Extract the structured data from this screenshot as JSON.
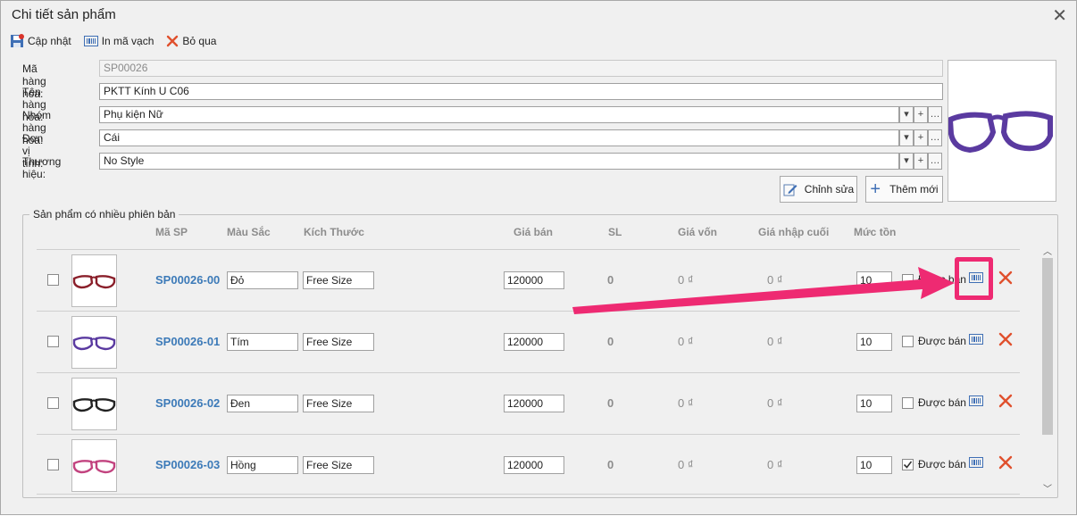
{
  "window": {
    "title": "Chi tiết sản phẩm"
  },
  "toolbar": {
    "update_label": "Cập nhật",
    "barcode_label": "In mã vạch",
    "skip_label": "Bỏ qua"
  },
  "form": {
    "code_label": "Mã hàng hóa:",
    "code_value": "SP00026",
    "name_label": "Tên hàng hóa:",
    "name_value": "PKTT Kính U C06",
    "group_label": "Nhóm hàng hóa:",
    "group_value": "Phụ kiện Nữ",
    "unit_label": "Đơn vị tính:",
    "unit_value": "Cái",
    "brand_label": "Thương hiệu:",
    "brand_value": "No Style"
  },
  "actions": {
    "edit_label": "Chỉnh sửa",
    "add_label": "Thêm mới"
  },
  "variants": {
    "title": "Sản phẩm có nhiều phiên bản",
    "columns": {
      "sku": "Mã SP",
      "color": "Màu Sắc",
      "size": "Kích Thước",
      "price": "Giá bán",
      "qty": "SL",
      "cost": "Giá vốn",
      "last_import": "Giá nhập cuối",
      "stock_level": "Mức tồn"
    },
    "rows": [
      {
        "sku": "SP00026-00",
        "color": "Đỏ",
        "size": "Free Size",
        "price": "120000",
        "qty": "0",
        "cost": "0 ₫",
        "last_import": "0 ₫",
        "stock_level": "10",
        "sell_label": "Được bán",
        "sell_checked": false,
        "frame_color": "#8a1f2a"
      },
      {
        "sku": "SP00026-01",
        "color": "Tím",
        "size": "Free Size",
        "price": "120000",
        "qty": "0",
        "cost": "0 ₫",
        "last_import": "0 ₫",
        "stock_level": "10",
        "sell_label": "Được bán",
        "sell_checked": false,
        "frame_color": "#5a3aa0"
      },
      {
        "sku": "SP00026-02",
        "color": "Đen",
        "size": "Free Size",
        "price": "120000",
        "qty": "0",
        "cost": "0 ₫",
        "last_import": "0 ₫",
        "stock_level": "10",
        "sell_label": "Được bán",
        "sell_checked": false,
        "frame_color": "#222222"
      },
      {
        "sku": "SP00026-03",
        "color": "Hồng",
        "size": "Free Size",
        "price": "120000",
        "qty": "0",
        "cost": "0 ₫",
        "last_import": "0 ₫",
        "stock_level": "10",
        "sell_label": "Được bán",
        "sell_checked": true,
        "frame_color": "#c2437f"
      }
    ]
  },
  "colors": {
    "accent_highlight": "#ee2a72",
    "sku_link": "#3c7ab8",
    "delete": "#e0502d"
  }
}
